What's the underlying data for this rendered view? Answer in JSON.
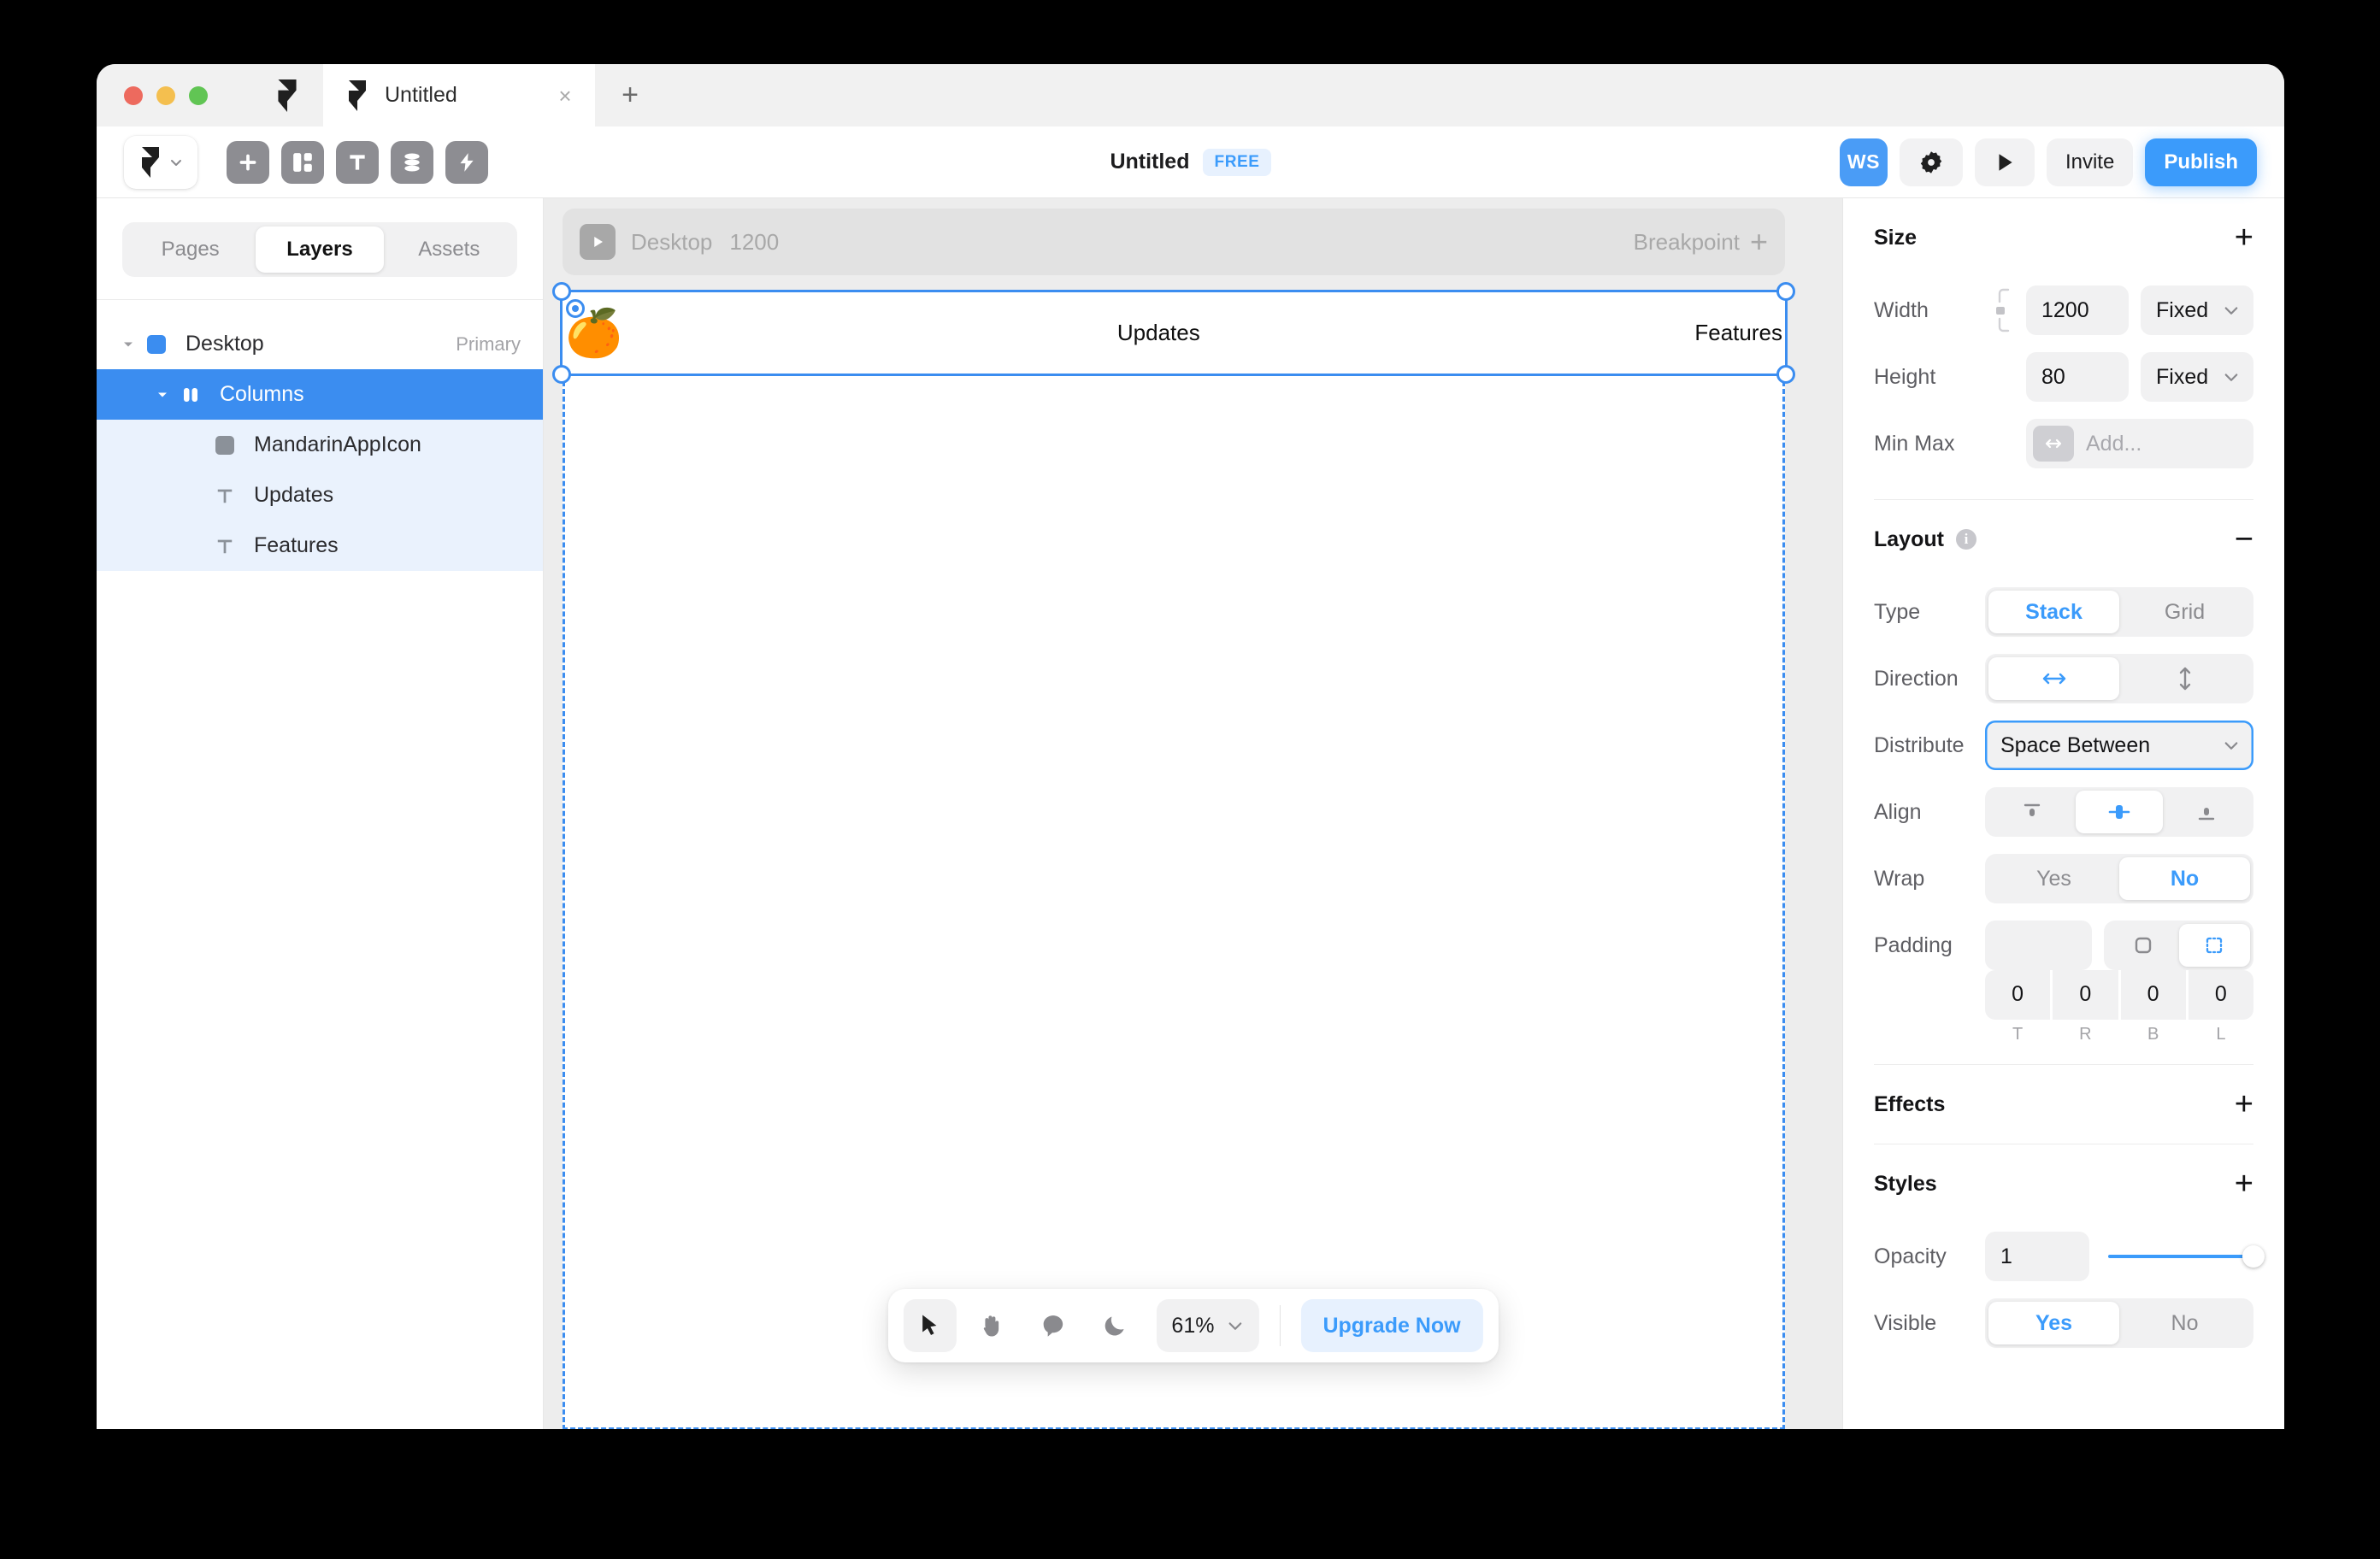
{
  "window": {
    "traffic_lights": [
      "close",
      "minimize",
      "maximize"
    ]
  },
  "tabbar": {
    "app_icon": "framer-logo-icon",
    "tab": {
      "title": "Untitled",
      "icon": "framer-logo-icon",
      "close": "×"
    },
    "new_tab": "+"
  },
  "toolbar": {
    "logo_label": "framer-menu",
    "icons": [
      {
        "name": "insert-icon",
        "glyph": "+"
      },
      {
        "name": "layout-icon",
        "glyph": "layout"
      },
      {
        "name": "text-icon",
        "glyph": "T"
      },
      {
        "name": "cms-icon",
        "glyph": "stack"
      },
      {
        "name": "effects-icon",
        "glyph": "bolt"
      }
    ],
    "doc_title": "Untitled",
    "plan_badge": "FREE",
    "avatar_initials": "WS",
    "settings_icon": "gear-icon",
    "preview_icon": "play-icon",
    "invite_label": "Invite",
    "publish_label": "Publish",
    "accent": "#3b9bfb"
  },
  "sidebar": {
    "tabs": [
      {
        "label": "Pages",
        "active": false
      },
      {
        "label": "Layers",
        "active": true
      },
      {
        "label": "Assets",
        "active": false
      }
    ],
    "tree": [
      {
        "label": "Desktop",
        "meta": "Primary",
        "icon": "frame-icon",
        "state": "normal"
      },
      {
        "label": "Columns",
        "meta": "",
        "icon": "stack-columns-icon",
        "state": "selected"
      },
      {
        "label": "MandarinAppIcon",
        "meta": "",
        "icon": "component-icon",
        "state": "child"
      },
      {
        "label": "Updates",
        "meta": "",
        "icon": "text-layer-icon",
        "state": "child"
      },
      {
        "label": "Features",
        "meta": "",
        "icon": "text-layer-icon",
        "state": "child"
      }
    ]
  },
  "canvas": {
    "breakpoint": {
      "name": "Desktop",
      "size": "1200",
      "right_label": "Breakpoint",
      "add": "+",
      "play_icon": "play-icon"
    },
    "selection": {
      "emoji": "🍊",
      "items": [
        "Updates",
        "Features"
      ],
      "selection_color": "#3b8df0"
    }
  },
  "floatbar": {
    "tools": [
      {
        "name": "cursor-tool",
        "active": true
      },
      {
        "name": "hand-tool",
        "active": false
      },
      {
        "name": "comment-tool",
        "active": false
      },
      {
        "name": "dark-mode-toggle",
        "active": false
      }
    ],
    "zoom": "61%",
    "zoom_chevron": "chevron-down-icon",
    "upgrade_label": "Upgrade Now"
  },
  "inspector": {
    "size": {
      "title": "Size",
      "add": "+",
      "width_label": "Width",
      "width_value": "1200",
      "width_mode": "Fixed",
      "height_label": "Height",
      "height_value": "80",
      "height_mode": "Fixed",
      "minmax_label": "Min Max",
      "minmax_placeholder": "Add...",
      "lock_icon": "link-lock-icon"
    },
    "layout": {
      "title": "Layout",
      "collapse": "−",
      "type_label": "Type",
      "type_options": [
        "Stack",
        "Grid"
      ],
      "type_value": "Stack",
      "direction_label": "Direction",
      "direction_value": "horizontal",
      "distribute_label": "Distribute",
      "distribute_value": "Space Between",
      "align_label": "Align",
      "align_value": "center",
      "wrap_label": "Wrap",
      "wrap_options": [
        "Yes",
        "No"
      ],
      "wrap_value": "No",
      "padding_label": "Padding",
      "padding_values": [
        "0",
        "0",
        "0",
        "0"
      ],
      "padding_labels": [
        "T",
        "R",
        "B",
        "L"
      ]
    },
    "effects": {
      "title": "Effects",
      "add": "+"
    },
    "styles": {
      "title": "Styles",
      "add": "+",
      "opacity_label": "Opacity",
      "opacity_value": "1",
      "visible_label": "Visible",
      "visible_options": [
        "Yes",
        "No"
      ],
      "visible_value": "Yes"
    }
  }
}
